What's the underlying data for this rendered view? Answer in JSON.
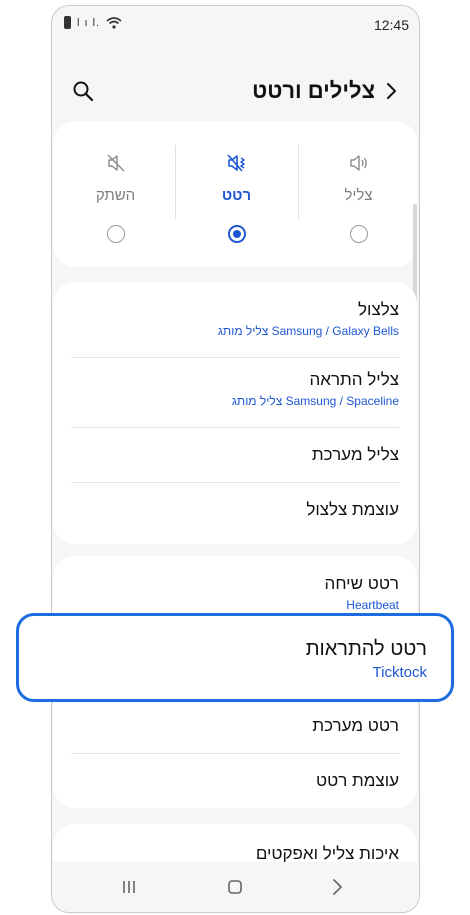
{
  "status": {
    "time": "12:45"
  },
  "header": {
    "title": "צלילים ורטט"
  },
  "modes": [
    {
      "label": "השתק",
      "selected": false,
      "icon": "mute-icon"
    },
    {
      "label": "רטט",
      "selected": true,
      "icon": "vibrate-icon"
    },
    {
      "label": "צליל",
      "selected": false,
      "icon": "sound-icon"
    }
  ],
  "sound_group": {
    "ringtone": {
      "title": "צלצול",
      "value": "Samsung / Galaxy Bells צליל מותג"
    },
    "notification_sound": {
      "title": "צליל התראה",
      "value": "Samsung / Spaceline צליל מותג"
    },
    "system_sound": {
      "title": "צליל מערכת"
    },
    "ring_volume": {
      "title": "עוצמת צלצול"
    }
  },
  "vibration_group": {
    "call_vibration": {
      "title": "רטט שיחה",
      "value": "Heartbeat"
    },
    "notification_vibration": {
      "title": "רטט להתראות",
      "value": "Ticktock"
    },
    "system_vibration": {
      "title": "רטט מערכת"
    },
    "vibration_intensity": {
      "title": "עוצמת רטט"
    }
  },
  "quality": {
    "title": "איכות צליל ואפקטים"
  },
  "accent_color": "#1e57d3",
  "highlight_color": "#1b6ce0"
}
